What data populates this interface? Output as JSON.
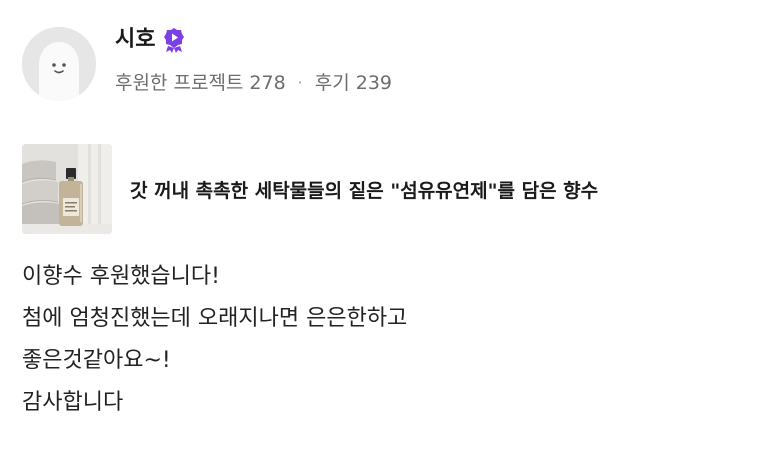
{
  "user": {
    "name": "시호",
    "badge_icon": "purple-play-badge-icon",
    "badge_color": "#7b3fe4"
  },
  "stats": {
    "backed_label": "후원한 프로젝트",
    "backed_count": "278",
    "separator": "·",
    "reviews_label": "후기",
    "reviews_count": "239"
  },
  "project": {
    "title": "갓 꺼내 촉촉한 세탁물들의 짙은 \"섬유유연제\"를 담은 향수",
    "thumbnail_icon": "perfume-bottle-on-towels-image"
  },
  "review": {
    "lines": [
      "이향수 후원했습니다!",
      "첨에 엄청진했는데 오래지나면 은은한하고",
      "좋은것같아요~!",
      "감사합니다"
    ]
  }
}
